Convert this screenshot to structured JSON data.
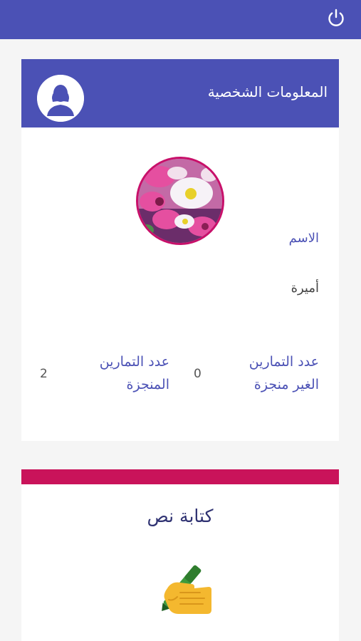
{
  "topbar": {
    "power_icon": "power-icon"
  },
  "profile": {
    "title": "المعلومات الشخصية",
    "header_icon": "user-avatar-icon",
    "name_label": "الاسم",
    "name_value": "أميرة",
    "stats": {
      "incomplete_label_line1": "عدد التمارين",
      "incomplete_label_line2": "الغير منجزة",
      "incomplete_value": "0",
      "complete_label_line1": "عدد التمارين",
      "complete_label_line2": "المنجزة",
      "complete_value": "2"
    }
  },
  "writing": {
    "title": "كتابة نص",
    "icon": "writing-hand-icon"
  },
  "colors": {
    "primary": "#4b51b5",
    "accent": "#c9135a"
  }
}
